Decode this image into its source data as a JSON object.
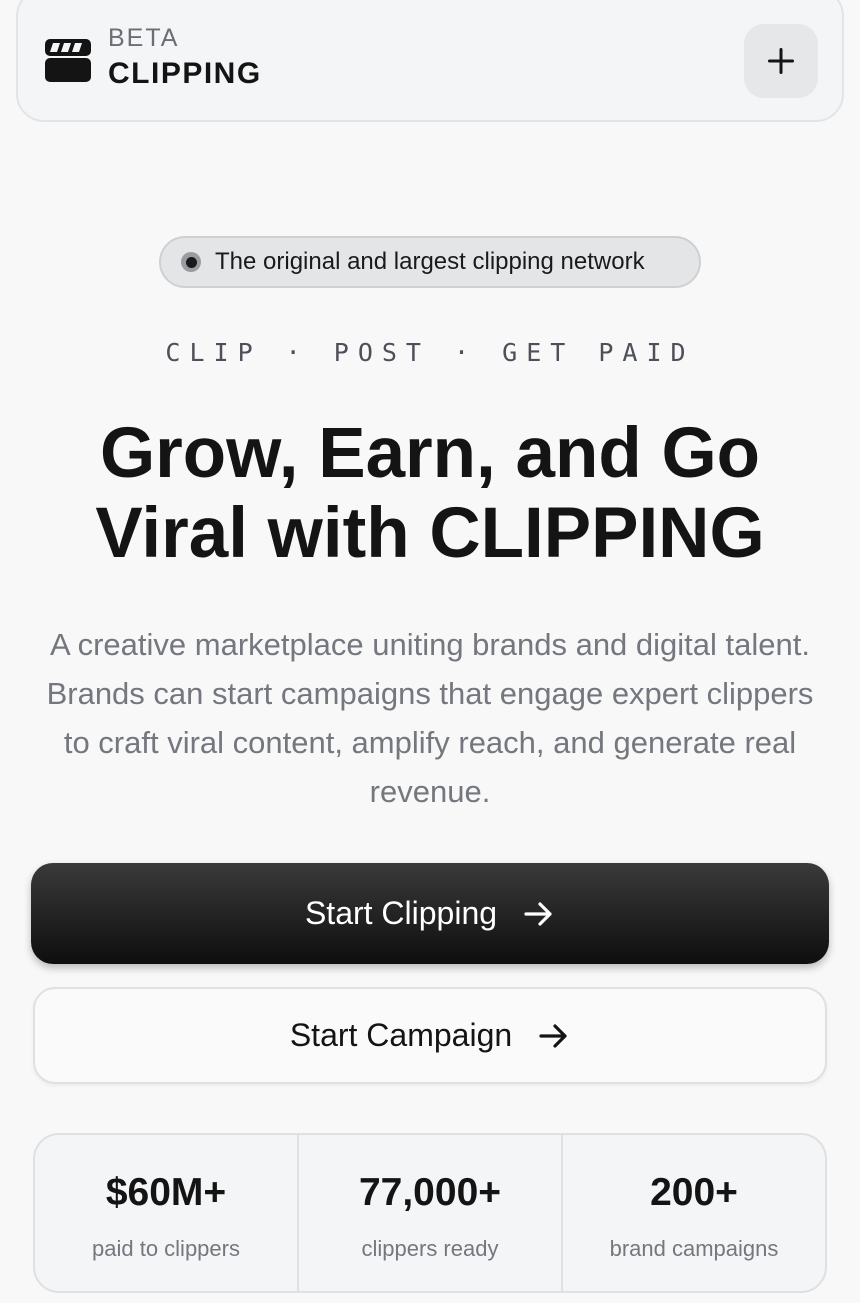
{
  "header": {
    "brand_tag": "BETA",
    "brand_name": "CLIPPING",
    "logo_icon": "clapperboard-icon",
    "action_icon": "plus-icon"
  },
  "hero": {
    "pill_text": "The original and largest clipping network",
    "tagline": "CLIP · POST · GET PAID",
    "headline": "Grow, Earn, and Go Viral with CLIPPING",
    "description": "A creative marketplace uniting brands and digital talent. Brands can start campaigns that engage expert clippers to craft viral content, amplify reach, and generate real revenue."
  },
  "buttons": {
    "primary_label": "Start Clipping",
    "secondary_label": "Start Campaign",
    "arrow_icon": "arrow-right-icon"
  },
  "stats": [
    {
      "value": "$60M+",
      "label": "paid to clippers"
    },
    {
      "value": "77,000+",
      "label": "clippers ready"
    },
    {
      "value": "200+",
      "label": "brand campaigns"
    }
  ],
  "colors": {
    "background": "#f8f8f9",
    "text_primary": "#141414",
    "text_muted": "#74777e",
    "primary_button": "#141414"
  }
}
